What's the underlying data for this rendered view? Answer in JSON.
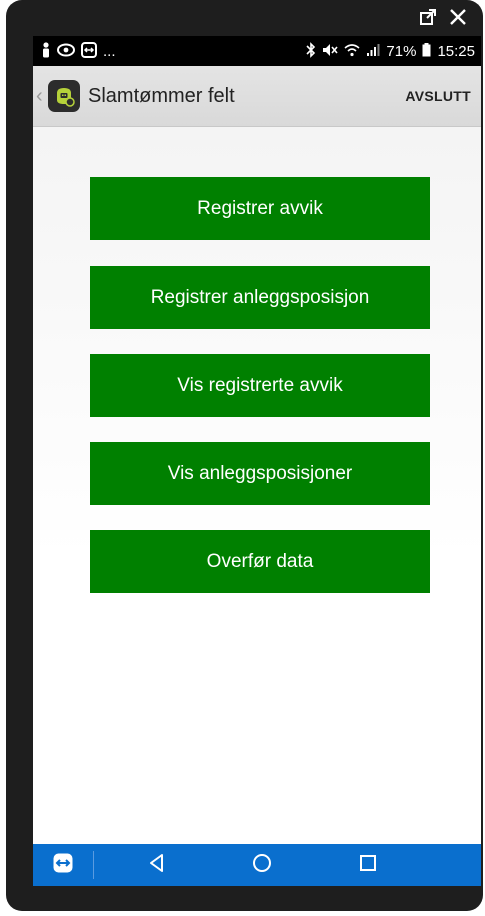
{
  "statusbar": {
    "left_text": "...",
    "battery": "71%",
    "time": "15:25"
  },
  "actionbar": {
    "title": "Slamtømmer felt",
    "exit_label": "AVSLUTT"
  },
  "menu": {
    "buttons": [
      {
        "label": "Registrer avvik"
      },
      {
        "label": "Registrer anleggsposisjon"
      },
      {
        "label": "Vis registrerte avvik"
      },
      {
        "label": "Vis anleggsposisjoner"
      },
      {
        "label": "Overfør data"
      }
    ]
  },
  "colors": {
    "button_green": "#008000",
    "navbar_blue": "#0a6fce"
  },
  "icons": {
    "window": [
      "popout-icon",
      "close-icon"
    ],
    "status_left": [
      "person-icon",
      "eye-icon",
      "teamviewer-icon"
    ],
    "status_right": [
      "bluetooth-icon",
      "mute-icon",
      "wifi-icon",
      "signal-icon",
      "battery-icon"
    ],
    "nav": [
      "teamviewer-icon",
      "back-icon",
      "home-icon",
      "recents-icon"
    ]
  }
}
